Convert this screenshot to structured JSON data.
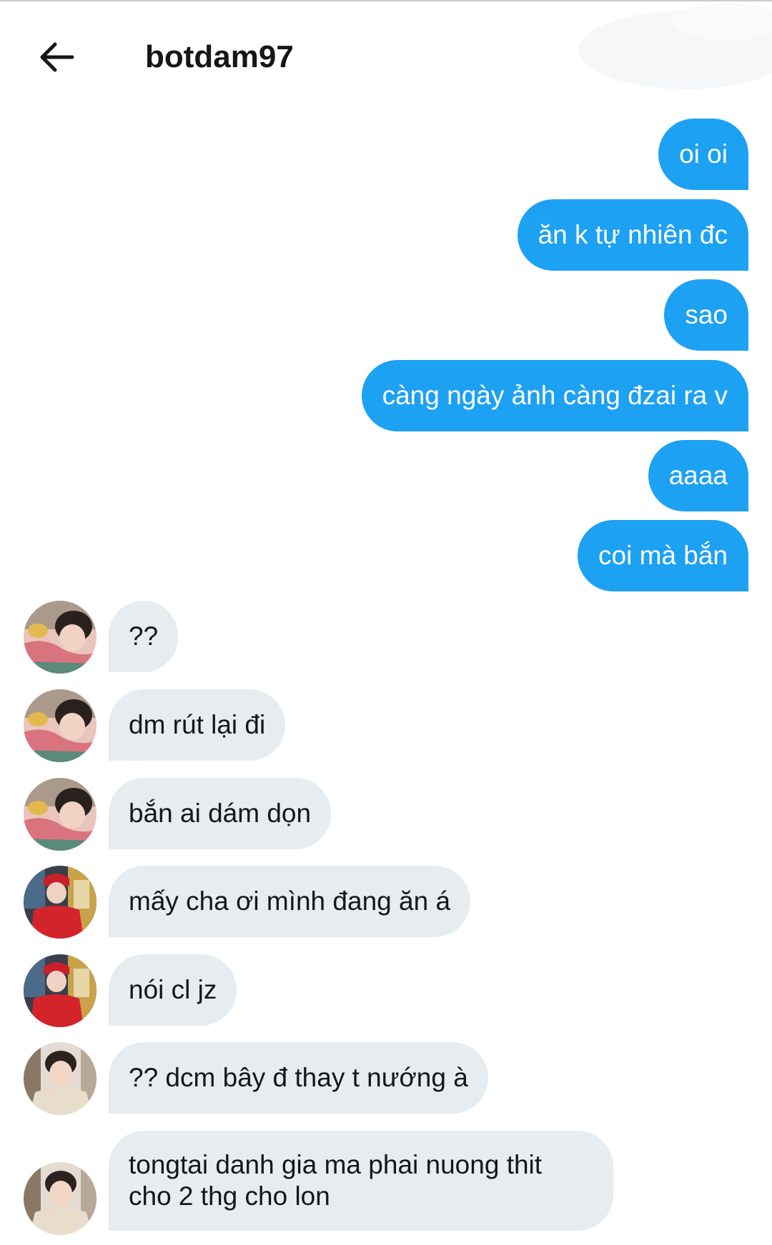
{
  "header": {
    "title": "botdam97",
    "back_icon": "arrow-left-icon"
  },
  "colors": {
    "sent_bubble": "#1da1f2",
    "received_bubble": "#e6ecf0",
    "text": "#14171a"
  },
  "messages": {
    "sent": [
      "oi oi",
      "ăn k tự nhiên đc",
      "sao",
      "càng ngày ảnh càng đzai ra v",
      "aaaa",
      "coi mà bắn"
    ],
    "received": [
      {
        "text": "??",
        "avatar": "avatar-pink-sweater"
      },
      {
        "text": "dm rút lại đi",
        "avatar": "avatar-pink-sweater"
      },
      {
        "text": "bắn ai dám dọn",
        "avatar": "avatar-pink-sweater"
      },
      {
        "text": "mấy cha ơi mình đang ăn á",
        "avatar": "avatar-red-cap"
      },
      {
        "text": "nói cl jz",
        "avatar": "avatar-red-cap"
      },
      {
        "text": "?? dcm bây đ thay t nướng à",
        "avatar": "avatar-beige-jacket"
      },
      {
        "text_line1": "tongtai danh gia ma phai nuong thit",
        "text_line2": "cho 2 thg cho lon",
        "avatar": "avatar-beige-jacket"
      }
    ]
  }
}
